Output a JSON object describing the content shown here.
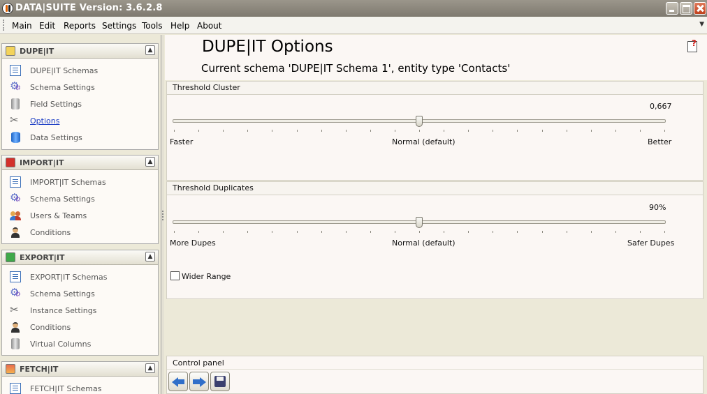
{
  "window": {
    "title": "DATA|SUITE Version: 3.6.2.8"
  },
  "menu": [
    "Main",
    "Edit",
    "Reports",
    "Settings",
    "Tools",
    "Help",
    "About"
  ],
  "sidebar": {
    "sections": [
      {
        "title": "DUPE|IT",
        "items": [
          "DUPE|IT Schemas",
          "Schema Settings",
          "Field Settings",
          "Options",
          "Data Settings"
        ]
      },
      {
        "title": "IMPORT|IT",
        "items": [
          "IMPORT|IT Schemas",
          "Schema Settings",
          "Users & Teams",
          "Conditions"
        ]
      },
      {
        "title": "EXPORT|IT",
        "items": [
          "EXPORT|IT Schemas",
          "Schema Settings",
          "Instance Settings",
          "Conditions",
          "Virtual Columns"
        ]
      },
      {
        "title": "FETCH|IT",
        "items": [
          "FETCH|IT Schemas"
        ]
      }
    ],
    "active_item": "Options"
  },
  "main": {
    "title": "DUPE|IT Options",
    "subtitle": "Current schema 'DUPE|IT Schema 1', entity type 'Contacts'",
    "threshold_cluster": {
      "title": "Threshold Cluster",
      "value_text": "0,667",
      "position": 0.5,
      "label_left": "Faster",
      "label_mid": "Normal (default)",
      "label_right": "Better"
    },
    "threshold_duplicates": {
      "title": "Threshold Duplicates",
      "value_text": "90%",
      "position": 0.5,
      "label_left": "More Dupes",
      "label_mid": "Normal (default)",
      "label_right": "Safer Dupes"
    },
    "wider_range": {
      "label": "Wider Range",
      "checked": false
    },
    "control_panel": {
      "title": "Control panel"
    }
  },
  "colors": {
    "link": "#1a3cc4",
    "accent_blue": "#2f6ec9",
    "titlebar": "#8c877c"
  }
}
